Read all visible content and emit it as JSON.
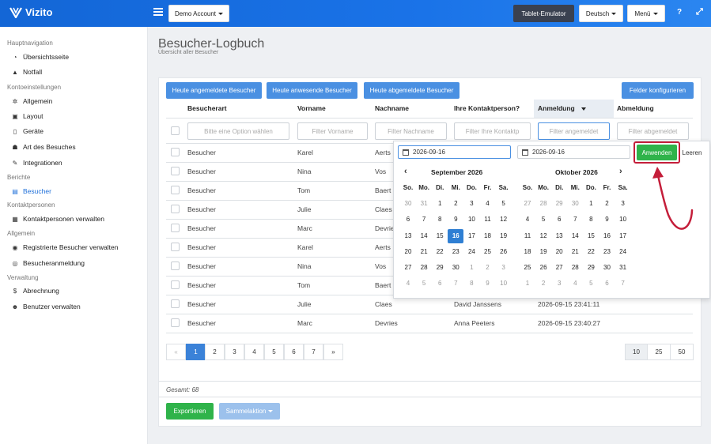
{
  "app": {
    "name": "Vizito"
  },
  "topbar": {
    "account": "Demo Account",
    "tablet": "Tablet-Emulator",
    "language": "Deutsch",
    "menu": "Menü",
    "help": "?",
    "expand": "⤢"
  },
  "sidebar": {
    "sections": [
      {
        "title": "Hauptnavigation",
        "items": [
          {
            "label": "Übersichtsseite",
            "icon": "dashboard-icon"
          },
          {
            "label": "Notfall",
            "icon": "warning-icon"
          }
        ]
      },
      {
        "title": "Kontoeinstellungen",
        "items": [
          {
            "label": "Allgemein",
            "icon": "gear-icon"
          },
          {
            "label": "Layout",
            "icon": "image-icon"
          },
          {
            "label": "Geräte",
            "icon": "tablet-icon"
          },
          {
            "label": "Art des Besuches",
            "icon": "users-icon"
          },
          {
            "label": "Integrationen",
            "icon": "plug-icon"
          }
        ]
      },
      {
        "title": "Berichte",
        "items": [
          {
            "label": "Besucher",
            "icon": "book-icon",
            "active": true
          }
        ]
      },
      {
        "title": "Kontaktpersonen",
        "items": [
          {
            "label": "Kontaktpersonen verwalten",
            "icon": "user-card-icon"
          }
        ]
      },
      {
        "title": "Allgemein",
        "items": [
          {
            "label": "Registrierte Besucher verwalten",
            "icon": "user-circle-icon"
          },
          {
            "label": "Besucheranmeldung",
            "icon": "user-check-icon"
          }
        ]
      },
      {
        "title": "Verwaltung",
        "items": [
          {
            "label": "Abrechnung",
            "icon": "dollar-icon"
          },
          {
            "label": "Benutzer verwalten",
            "icon": "user-plus-icon"
          }
        ]
      }
    ]
  },
  "page": {
    "title": "Besucher-Logbuch",
    "subtitle": "Übersicht aller Besucher"
  },
  "quick_filters": [
    "Heute angemeldete Besucher",
    "Heute anwesende Besucher",
    "Heute abgemeldete Besucher"
  ],
  "configure_fields": "Felder konfigurieren",
  "columns": [
    "Besucherart",
    "Vorname",
    "Nachname",
    "Ihre Kontaktperson?",
    "Anmeldung",
    "Abmeldung"
  ],
  "filters": {
    "type": "Bitte eine Option wählen",
    "firstname": "Filter Vorname",
    "lastname": "Filter Nachname",
    "contact": "Filter Ihre Kontaktp",
    "checkin": "Filter angemeldet",
    "checkout": "Filter abgemeldet"
  },
  "rows": [
    {
      "type": "Besucher",
      "first": "Karel",
      "last": "Aerts",
      "contact": "",
      "checkin": ""
    },
    {
      "type": "Besucher",
      "first": "Nina",
      "last": "Vos",
      "contact": "",
      "checkin": ""
    },
    {
      "type": "Besucher",
      "first": "Tom",
      "last": "Baert",
      "contact": "",
      "checkin": ""
    },
    {
      "type": "Besucher",
      "first": "Julie",
      "last": "Claes",
      "contact": "",
      "checkin": ""
    },
    {
      "type": "Besucher",
      "first": "Marc",
      "last": "Devrie",
      "contact": "",
      "checkin": ""
    },
    {
      "type": "Besucher",
      "first": "Karel",
      "last": "Aerts",
      "contact": "",
      "checkin": ""
    },
    {
      "type": "Besucher",
      "first": "Nina",
      "last": "Vos",
      "contact": "",
      "checkin": ""
    },
    {
      "type": "Besucher",
      "first": "Tom",
      "last": "Baert",
      "contact": "",
      "checkin": ""
    },
    {
      "type": "Besucher",
      "first": "Julie",
      "last": "Claes",
      "contact": "David Janssens",
      "checkin": "2026-09-15 23:41:11"
    },
    {
      "type": "Besucher",
      "first": "Marc",
      "last": "Devries",
      "contact": "Anna Peeters",
      "checkin": "2026-09-15 23:40:27"
    }
  ],
  "pagination": {
    "prev": "«",
    "pages": [
      "1",
      "2",
      "3",
      "4",
      "5",
      "6",
      "7"
    ],
    "next": "»",
    "page_sizes": [
      "10",
      "25",
      "50"
    ]
  },
  "total": "Gesamt: 68",
  "footer": {
    "export": "Exportieren",
    "bulk": "Sammelaktion"
  },
  "datepicker": {
    "start": "2026-09-16",
    "end": "2026-09-16",
    "apply": "Anwenden",
    "clear": "Leeren",
    "weekdays": [
      "So.",
      "Mo.",
      "Di.",
      "Mi.",
      "Do.",
      "Fr.",
      "Sa."
    ],
    "months": [
      {
        "title": "September 2026",
        "days": [
          [
            "30",
            "31",
            "1",
            "2",
            "3",
            "4",
            "5"
          ],
          [
            "6",
            "7",
            "8",
            "9",
            "10",
            "11",
            "12"
          ],
          [
            "13",
            "14",
            "15",
            "16",
            "17",
            "18",
            "19"
          ],
          [
            "20",
            "21",
            "22",
            "23",
            "24",
            "25",
            "26"
          ],
          [
            "27",
            "28",
            "29",
            "30",
            "1",
            "2",
            "3"
          ],
          [
            "4",
            "5",
            "6",
            "7",
            "8",
            "9",
            "10"
          ]
        ],
        "other_rows": {
          "0": [
            0,
            1
          ],
          "4": [
            4,
            5,
            6
          ],
          "5": [
            0,
            1,
            2,
            3,
            4,
            5,
            6
          ]
        },
        "selected": "16"
      },
      {
        "title": "Oktober 2026",
        "days": [
          [
            "27",
            "28",
            "29",
            "30",
            "1",
            "2",
            "3"
          ],
          [
            "4",
            "5",
            "6",
            "7",
            "8",
            "9",
            "10"
          ],
          [
            "11",
            "12",
            "13",
            "14",
            "15",
            "16",
            "17"
          ],
          [
            "18",
            "19",
            "20",
            "21",
            "22",
            "23",
            "24"
          ],
          [
            "25",
            "26",
            "27",
            "28",
            "29",
            "30",
            "31"
          ],
          [
            "1",
            "2",
            "3",
            "4",
            "5",
            "6",
            "7"
          ]
        ],
        "other_rows": {
          "0": [
            0,
            1,
            2,
            3
          ],
          "5": [
            0,
            1,
            2,
            3,
            4,
            5,
            6
          ]
        },
        "selected": ""
      }
    ]
  },
  "colors": {
    "primary": "#1a73e8",
    "button": "#4a90e2",
    "apply": "#2fb34a",
    "annotation": "#c41e3a"
  }
}
